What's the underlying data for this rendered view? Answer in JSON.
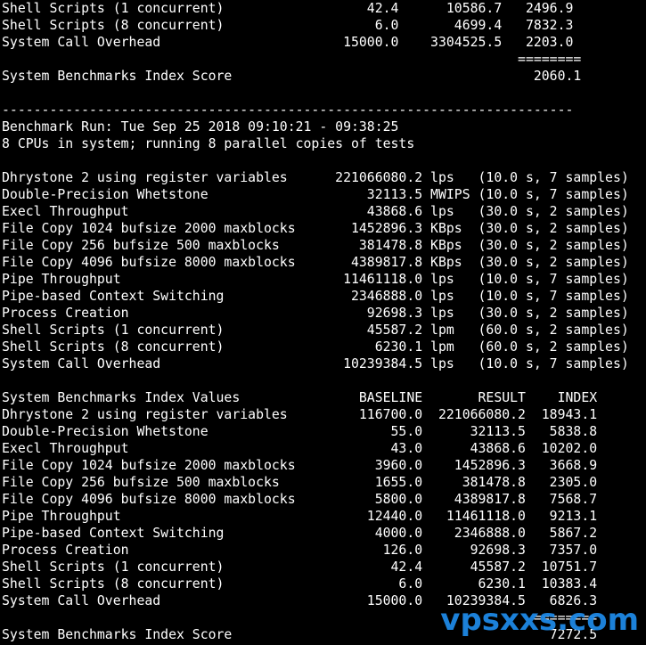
{
  "terminal": {
    "lines": [
      "Shell Scripts (1 concurrent)                  42.4      10586.7   2496.9",
      "Shell Scripts (8 concurrent)                   6.0       4699.4   7832.3",
      "System Call Overhead                       15000.0    3304525.5   2203.0",
      "                                                                 ========",
      "System Benchmarks Index Score                                      2060.1",
      "",
      "------------------------------------------------------------------------",
      "Benchmark Run: Tue Sep 25 2018 09:10:21 - 09:38:25",
      "8 CPUs in system; running 8 parallel copies of tests",
      "",
      "Dhrystone 2 using register variables      221066080.2 lps   (10.0 s, 7 samples)",
      "Double-Precision Whetstone                    32113.5 MWIPS (10.0 s, 7 samples)",
      "Execl Throughput                              43868.6 lps   (30.0 s, 2 samples)",
      "File Copy 1024 bufsize 2000 maxblocks       1452896.3 KBps  (30.0 s, 2 samples)",
      "File Copy 256 bufsize 500 maxblocks          381478.8 KBps  (30.0 s, 2 samples)",
      "File Copy 4096 bufsize 8000 maxblocks       4389817.8 KBps  (30.0 s, 2 samples)",
      "Pipe Throughput                            11461118.0 lps   (10.0 s, 7 samples)",
      "Pipe-based Context Switching                2346888.0 lps   (10.0 s, 7 samples)",
      "Process Creation                              92698.3 lps   (30.0 s, 2 samples)",
      "Shell Scripts (1 concurrent)                  45587.2 lpm   (60.0 s, 2 samples)",
      "Shell Scripts (8 concurrent)                   6230.1 lpm   (60.0 s, 2 samples)",
      "System Call Overhead                       10239384.5 lps   (10.0 s, 7 samples)",
      "",
      "System Benchmarks Index Values               BASELINE       RESULT    INDEX",
      "Dhrystone 2 using register variables         116700.0  221066080.2  18943.1",
      "Double-Precision Whetstone                       55.0      32113.5   5838.8",
      "Execl Throughput                                 43.0      43868.6  10202.0",
      "File Copy 1024 bufsize 2000 maxblocks          3960.0    1452896.3   3668.9",
      "File Copy 256 bufsize 500 maxblocks            1655.0     381478.8   2305.0",
      "File Copy 4096 bufsize 8000 maxblocks          5800.0    4389817.8   7568.7",
      "Pipe Throughput                               12440.0   11461118.0   9213.1",
      "Pipe-based Context Switching                   4000.0    2346888.0   5867.2",
      "Process Creation                                126.0      92698.3   7357.0",
      "Shell Scripts (1 concurrent)                     42.4      45587.2  10751.7",
      "Shell Scripts (8 concurrent)                      6.0       6230.1  10383.4",
      "System Call Overhead                          15000.0   10239384.5   6826.3",
      "                                                                   ========",
      "System Benchmarks Index Score                                        7272.5"
    ]
  },
  "watermark": {
    "text": "vpsxxs.com",
    "color": "#1e88e5"
  }
}
